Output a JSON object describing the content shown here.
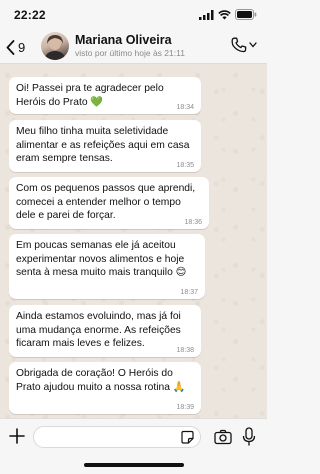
{
  "status_bar": {
    "time": "22:22"
  },
  "header": {
    "back_count": "9",
    "contact_name": "Mariana Oliveira",
    "contact_status": "visto por último hoje às 21:11"
  },
  "messages": [
    {
      "text": "Oi! Passei pra te agradecer pelo Heróis do Prato 💚",
      "time": "18:34"
    },
    {
      "text": "Meu filho tinha muita seletividade alimentar e as refeições aqui em casa eram sempre tensas.",
      "time": "18:35"
    },
    {
      "text": "Com os pequenos passos que aprendi, comecei a entender melhor o tempo dele e parei de forçar.",
      "time": "18:36"
    },
    {
      "text": "Em poucas semanas ele já aceitou experimentar novos alimentos e hoje senta à mesa muito mais tranquilo 😊",
      "time": "18:37"
    },
    {
      "text": "Ainda estamos evoluindo, mas já foi uma mudança enorme. As refeições ficaram mais leves e felizes.",
      "time": "18:38"
    },
    {
      "text": "Obrigada de coração! O Heróis do Prato ajudou muito a nossa rotina 🙏",
      "time": "18:39"
    }
  ],
  "composer": {
    "input_value": "",
    "placeholder": ""
  },
  "colors": {
    "accent": "#000000",
    "chat_background": "#ece5dd",
    "bubble": "#ffffff"
  }
}
